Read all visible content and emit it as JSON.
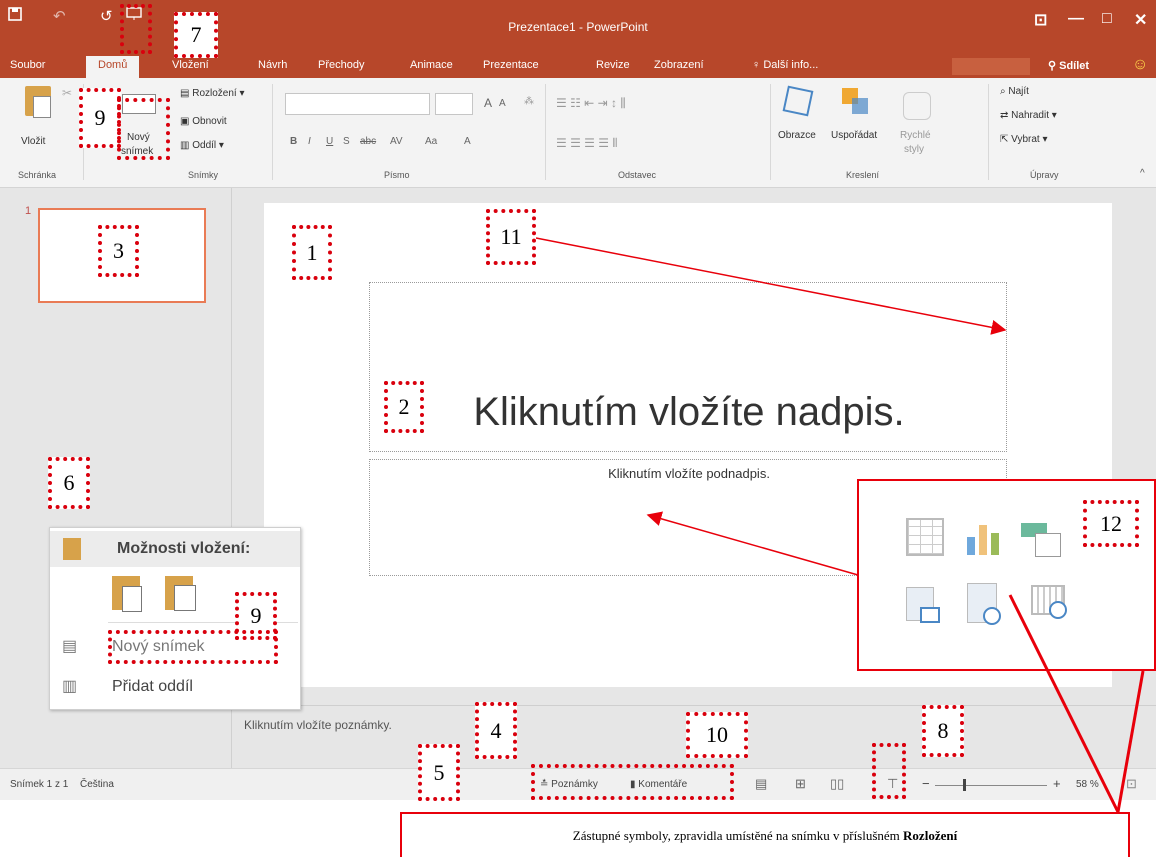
{
  "window": {
    "title": "Prezentace1 - PowerPoint"
  },
  "qat": {
    "save_icon": "save-icon",
    "undo_icon": "undo-icon",
    "redo_icon": "redo-icon",
    "present_icon": "start-presentation-icon"
  },
  "window_controls": {
    "restore": "⊡",
    "minimize": "—",
    "maximize": "□",
    "close": "✕"
  },
  "tabs": [
    "Soubor",
    "Domů",
    "Vložení",
    "Návrh",
    "Přechody",
    "Animace",
    "Prezentace",
    "Revize",
    "Zobrazení"
  ],
  "tell_me": "Další info...",
  "share": "Sdílet",
  "ribbon": {
    "clipboard": {
      "paste": "Vložit",
      "group": "Schránka"
    },
    "slides": {
      "new_slide_1": "Nový",
      "new_slide_2": "snímek",
      "layout": "Rozložení",
      "reset": "Obnovit",
      "section": "Oddíl",
      "group": "Snímky"
    },
    "font": {
      "group": "Písmo",
      "bold": "B",
      "italic": "I",
      "underline": "U",
      "strike": "S",
      "abc": "abc",
      "spacing": "AV",
      "case": "Aa",
      "color": "A",
      "grow": "A",
      "shrink": "A"
    },
    "paragraph": {
      "group": "Odstavec"
    },
    "drawing": {
      "shapes": "Obrazce",
      "arrange": "Uspořádat",
      "quick1": "Rychlé",
      "quick2": "styly",
      "group": "Kreslení"
    },
    "editing": {
      "find": "Najít",
      "replace": "Nahradit",
      "select": "Vybrat",
      "group": "Úpravy"
    }
  },
  "thumbnail": {
    "number": "1"
  },
  "slide": {
    "title_placeholder": "Kliknutím vložíte nadpis.",
    "subtitle_placeholder": "Kliknutím vložíte podnadpis."
  },
  "notes": {
    "placeholder": "Kliknutím vložíte poznámky."
  },
  "context_menu": {
    "heading": "Možnosti vložení:",
    "new_slide": "Nový snímek",
    "add_section": "Přidat oddíl"
  },
  "status": {
    "slide": "Snímek 1 z 1",
    "language": "Čeština",
    "notes": "Poznámky",
    "comments": "Komentáře",
    "zoom": "58 %"
  },
  "markers": {
    "m1": "1",
    "m2": "2",
    "m3": "3",
    "m4": "4",
    "m5": "5",
    "m6": "6",
    "m7": "7",
    "m8": "8",
    "m9a": "9",
    "m9b": "9",
    "m10": "10",
    "m11": "11",
    "m12": "12"
  },
  "callout": {
    "text": "Zástupné symboly, zpravidla umístěné na snímku v příslušném",
    "bold": "Rozložení"
  },
  "colors": {
    "accent": "#b7472a",
    "marker": "#d9000d",
    "thumb_border": "#e97b55"
  }
}
